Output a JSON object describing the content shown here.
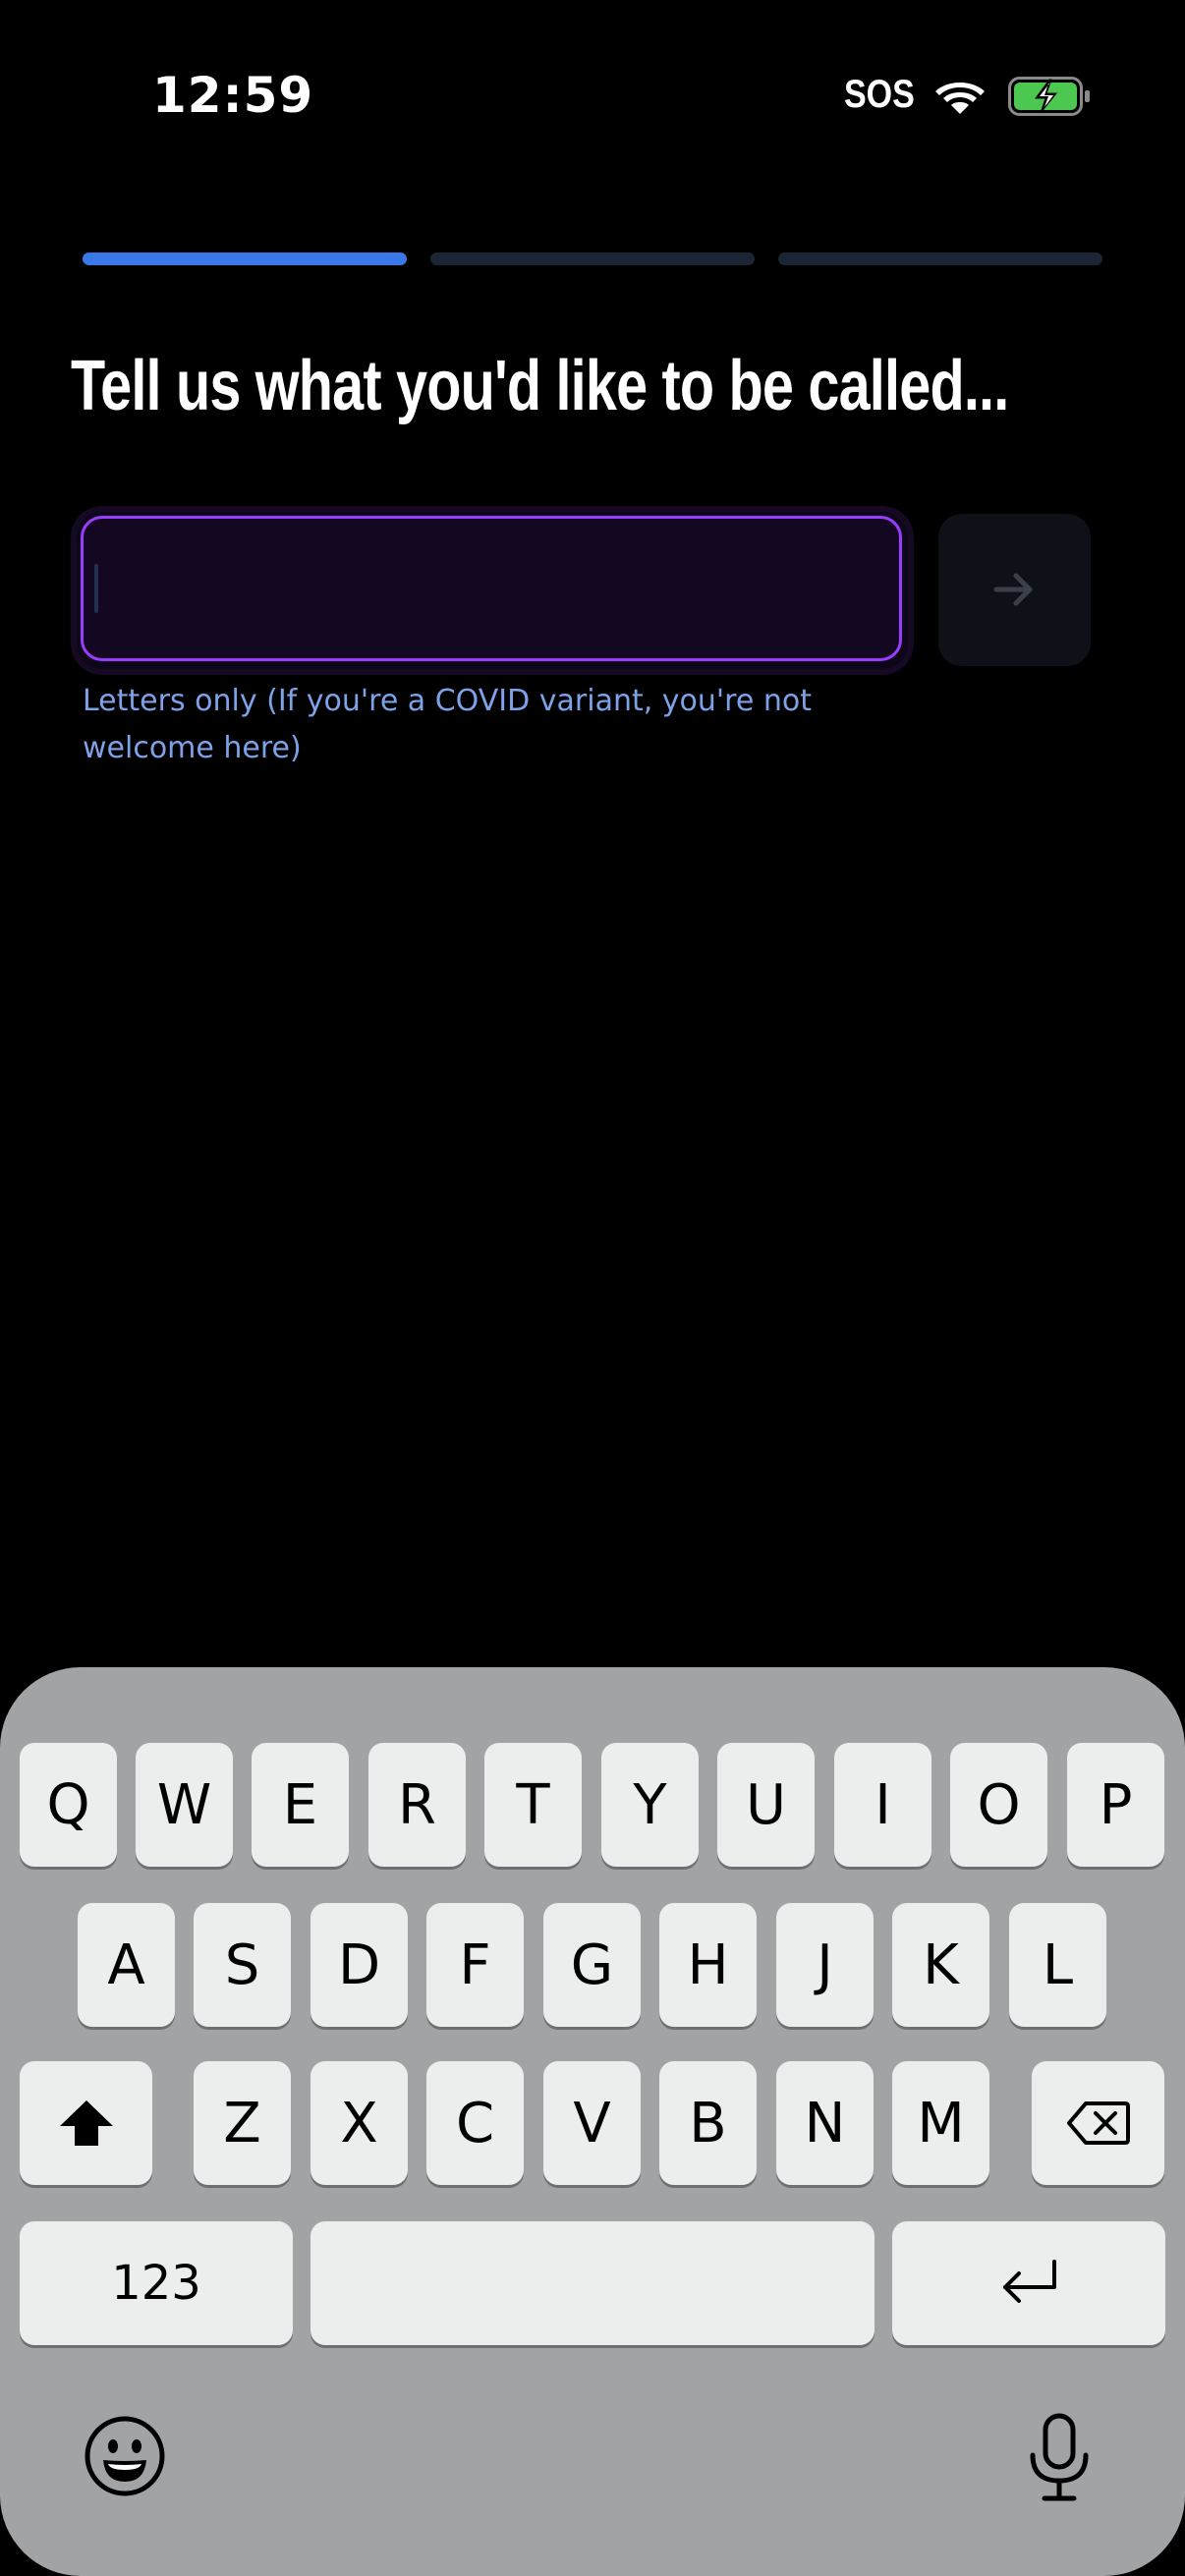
{
  "status_bar": {
    "time": "12:59",
    "sos": "SOS",
    "wifi_icon": "wifi-icon",
    "battery_icon": "battery-charging-icon",
    "battery_color": "#4cc74f"
  },
  "progress": {
    "total_steps": 3,
    "current_step": 1,
    "active_color": "#3a78e8",
    "inactive_color": "#1b2535"
  },
  "title": "Tell us what you'd like to be called...",
  "name_field": {
    "value": "",
    "placeholder": "",
    "border_color": "#9a3cff"
  },
  "submit_icon": "arrow-right-icon",
  "helper_text": "Letters only (If you're a COVID variant, you're not welcome here)",
  "keyboard": {
    "row1": [
      "Q",
      "W",
      "E",
      "R",
      "T",
      "Y",
      "U",
      "I",
      "O",
      "P"
    ],
    "row2": [
      "A",
      "S",
      "D",
      "F",
      "G",
      "H",
      "J",
      "K",
      "L"
    ],
    "row3": [
      "Z",
      "X",
      "C",
      "V",
      "B",
      "N",
      "M"
    ],
    "numbers_label": "123",
    "shift_icon": "shift-icon",
    "delete_icon": "delete-icon",
    "return_icon": "return-icon",
    "emoji_icon": "emoji-icon",
    "mic_icon": "microphone-icon"
  }
}
